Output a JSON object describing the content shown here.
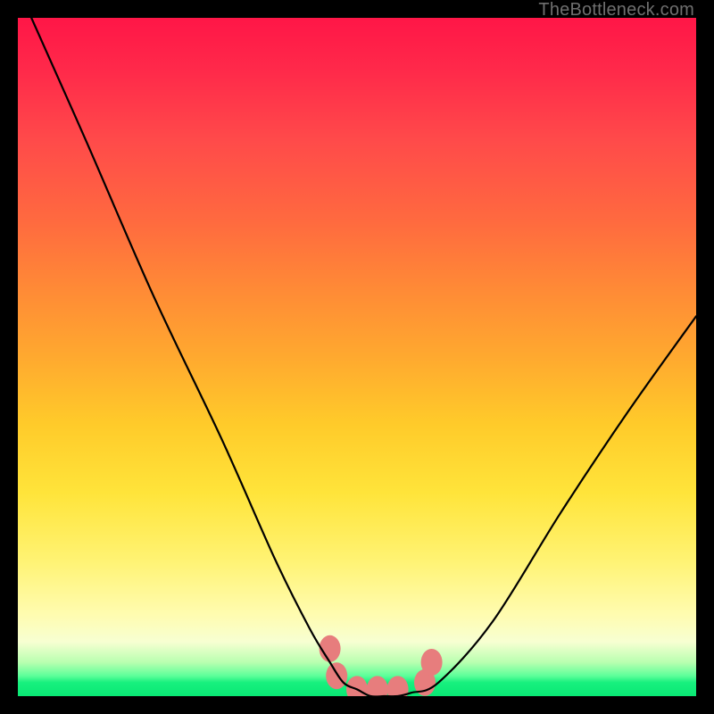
{
  "watermark": "TheBottleneck.com",
  "frame": {
    "outer_size_px": 800,
    "inner_size_px": 760,
    "border_px": 20,
    "border_color": "#000000"
  },
  "gradient_colors": {
    "top": "#ff1647",
    "mid_upper": "#ff8a36",
    "mid": "#ffe43a",
    "lower": "#fffcb0",
    "bottom": "#0ae874"
  },
  "chart_data": {
    "type": "line",
    "title": "",
    "xlabel": "",
    "ylabel": "",
    "xlim": [
      0,
      100
    ],
    "ylim": [
      0,
      100
    ],
    "grid": false,
    "legend": false,
    "series": [
      {
        "name": "bottleneck-curve",
        "x": [
          2,
          10,
          20,
          30,
          38,
          43,
          46,
          48,
          50,
          52,
          54,
          56,
          58,
          62,
          70,
          80,
          90,
          100
        ],
        "values": [
          100,
          82,
          59,
          38,
          20,
          10,
          5,
          2,
          1,
          0,
          0,
          0,
          0.5,
          2,
          11,
          27,
          42,
          56
        ]
      }
    ],
    "markers": [
      {
        "name": "pink-blob",
        "x": 46,
        "y": 7
      },
      {
        "name": "pink-blob",
        "x": 47,
        "y": 3
      },
      {
        "name": "pink-blob",
        "x": 50,
        "y": 1
      },
      {
        "name": "pink-blob",
        "x": 53,
        "y": 1
      },
      {
        "name": "pink-blob",
        "x": 56,
        "y": 1
      },
      {
        "name": "pink-blob",
        "x": 60,
        "y": 2
      },
      {
        "name": "pink-blob",
        "x": 61,
        "y": 5
      }
    ],
    "marker_style": {
      "color": "#e77d7d",
      "radius_px": 12
    }
  }
}
